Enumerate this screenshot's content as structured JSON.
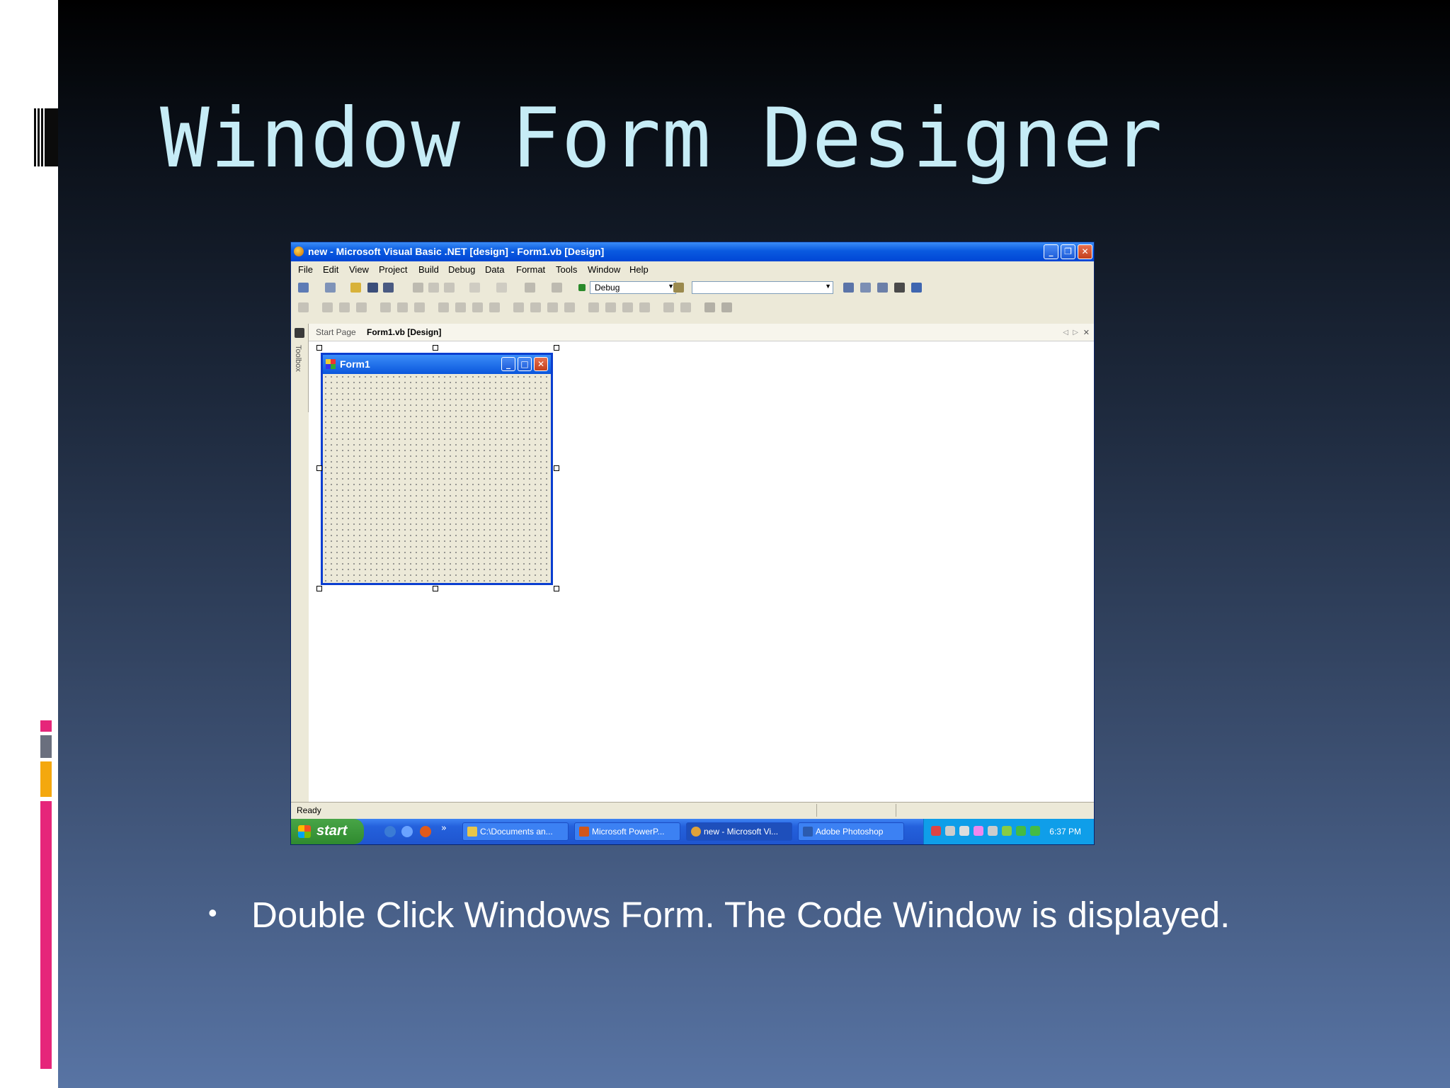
{
  "slide": {
    "title": "Window Form Designer",
    "bullet_symbol": "•",
    "bullet_text": "Double Click Windows Form. The Code Window is displayed."
  },
  "ide": {
    "window_title": "new - Microsoft Visual Basic .NET [design] - Form1.vb [Design]",
    "window_buttons": {
      "minimize": "_",
      "restore": "❐",
      "close": "✕"
    },
    "menu": [
      "File",
      "Edit",
      "View",
      "Project",
      "Build",
      "Debug",
      "Data",
      "Format",
      "Tools",
      "Window",
      "Help"
    ],
    "config_combo": "Debug",
    "find_combo": "",
    "toolbox_label": "Toolbox",
    "tabs": [
      "Start Page",
      "Form1.vb [Design]"
    ],
    "tab_controls": {
      "prev": "◁",
      "next": "▷",
      "close": "✕"
    },
    "form": {
      "title": "Form1",
      "buttons": {
        "minimize": "_",
        "maximize": "□",
        "close": "✕"
      }
    },
    "status_text": "Ready"
  },
  "taskbar": {
    "start_label": "start",
    "quicklaunch_more": "»",
    "tasks": [
      "C:\\Documents an...",
      "Microsoft PowerP...",
      "new - Microsoft Vi...",
      "Adobe Photoshop"
    ],
    "active_task_index": 2,
    "clock": "6:37 PM"
  },
  "colors": {
    "title_text": "#c6ecf6",
    "accent_pink": "#e6267a",
    "accent_gray": "#6a6f7e",
    "accent_orange": "#f4a80e",
    "xp_blue": "#0a5ae0",
    "xp_green": "#3a9b3a"
  }
}
